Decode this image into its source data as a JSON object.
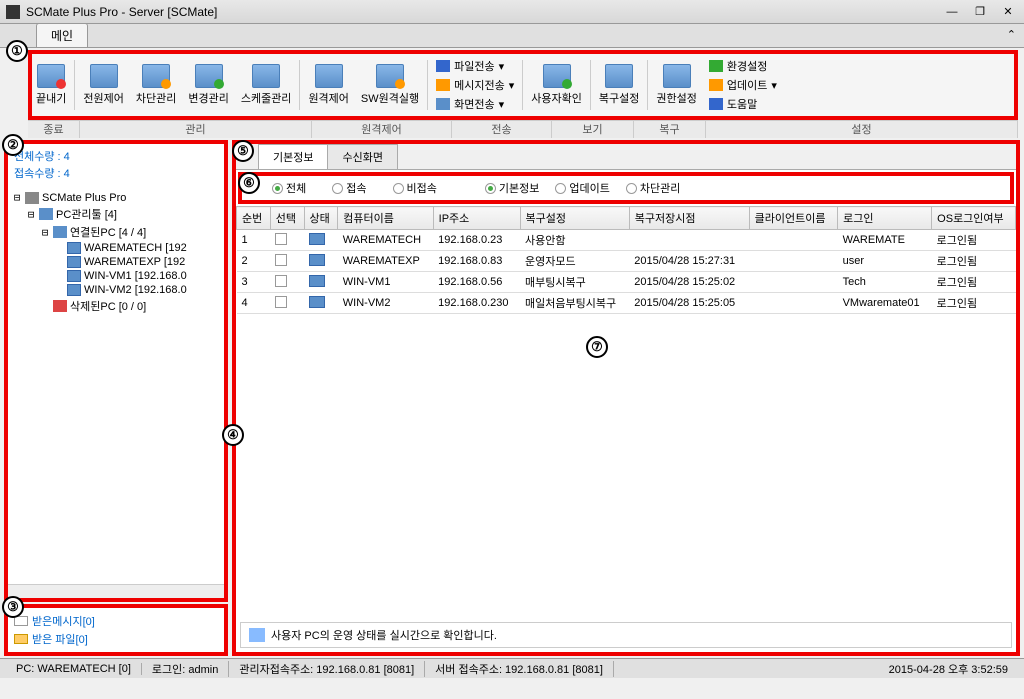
{
  "window": {
    "title": "SCMate Plus Pro - Server [SCMate]"
  },
  "maintab": "메인",
  "ribbon": {
    "items": {
      "exit": "끝내기",
      "power": "전원제어",
      "block": "차단관리",
      "change": "변경관리",
      "schedule": "스케줄관리",
      "remote": "원격제어",
      "swremote": "SW원격실행",
      "filesend": "파일전송",
      "msgsend": "메시지전송",
      "scrsend": "화면전송",
      "usercheck": "사용자확인",
      "restore": "복구설정",
      "perm": "권한설정",
      "env": "환경설정",
      "update": "업데이트",
      "help": "도움말"
    },
    "groups": {
      "exit": "종료",
      "manage": "관리",
      "remote": "원격제어",
      "send": "전송",
      "view": "보기",
      "restore": "복구",
      "setting": "설정"
    }
  },
  "counts": {
    "total_label": "전체수량 : 4",
    "connected_label": "접속수량 : 4"
  },
  "tree": {
    "root": "SCMate Plus Pro",
    "pcmgr": "PC관리툴 [4]",
    "connected": "연결된PC [4 / 4]",
    "nodes": [
      "WAREMATECH [192",
      "WAREMATEXP [192",
      "WIN-VM1 [192.168.0",
      "WIN-VM2 [192.168.0"
    ],
    "deleted": "삭제된PC [0 / 0]"
  },
  "bottom": {
    "msg": "받은메시지[0]",
    "file": "받은   파일[0]"
  },
  "tabs": {
    "basic": "기본정보",
    "recv": "수신화면"
  },
  "filters": {
    "left": [
      "전체",
      "접속",
      "비접속"
    ],
    "right": [
      "기본정보",
      "업데이트",
      "차단관리"
    ]
  },
  "table": {
    "headers": [
      "순번",
      "선택",
      "상태",
      "컴퓨터이름",
      "IP주소",
      "복구설정",
      "복구저장시점",
      "클라이언트이름",
      "로그인",
      "OS로그인여부"
    ],
    "rows": [
      {
        "no": "1",
        "name": "WAREMATECH",
        "ip": "192.168.0.23",
        "restore": "사용안함",
        "time": "",
        "client": "",
        "login": "WAREMATE",
        "os": "로그인됨"
      },
      {
        "no": "2",
        "name": "WAREMATEXP",
        "ip": "192.168.0.83",
        "restore": "운영자모드",
        "time": "2015/04/28 15:27:31",
        "client": "",
        "login": "user",
        "os": "로그인됨"
      },
      {
        "no": "3",
        "name": "WIN-VM1",
        "ip": "192.168.0.56",
        "restore": "매부팅시복구",
        "time": "2015/04/28 15:25:02",
        "client": "",
        "login": "Tech",
        "os": "로그인됨"
      },
      {
        "no": "4",
        "name": "WIN-VM2",
        "ip": "192.168.0.230",
        "restore": "매일처음부팅시복구",
        "time": "2015/04/28 15:25:05",
        "client": "",
        "login": "VMwaremate01",
        "os": "로그인됨"
      }
    ]
  },
  "desc": "사용자 PC의 운영 상태를 실시간으로 확인합니다.",
  "status": {
    "pc": "PC: WAREMATECH [0]",
    "login": "로그인: admin",
    "admin_addr": "관리자접속주소: 192.168.0.81 [8081]",
    "server_addr": "서버 접속주소: 192.168.0.81 [8081]",
    "datetime": "2015-04-28 오후 3:52:59"
  },
  "callouts": [
    "①",
    "②",
    "③",
    "④",
    "⑤",
    "⑥",
    "⑦"
  ]
}
